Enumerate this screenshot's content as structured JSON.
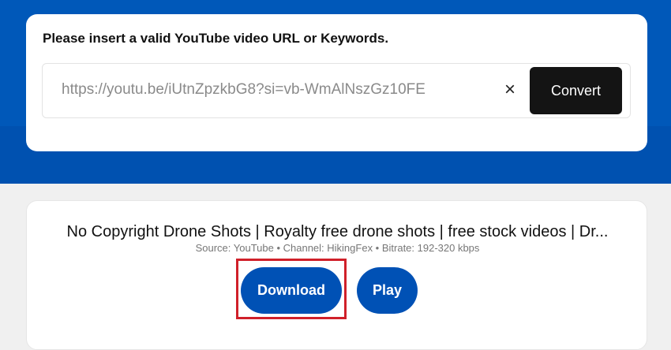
{
  "search": {
    "heading": "Please insert a valid YouTube video URL or Keywords.",
    "url_value": "https://youtu.be/iUtnZpzkbG8?si=vb-WmAlNszGz10FE",
    "clear_icon": "×",
    "convert_label": "Convert"
  },
  "result": {
    "title": "No Copyright Drone Shots | Royalty free drone shots | free stock videos | Dr...",
    "meta": "Source: YouTube • Channel: HikingFex • Bitrate: 192-320 kbps",
    "download_label": "Download",
    "play_label": "Play"
  },
  "colors": {
    "brand": "#0051b5",
    "highlight": "#d0202a"
  }
}
